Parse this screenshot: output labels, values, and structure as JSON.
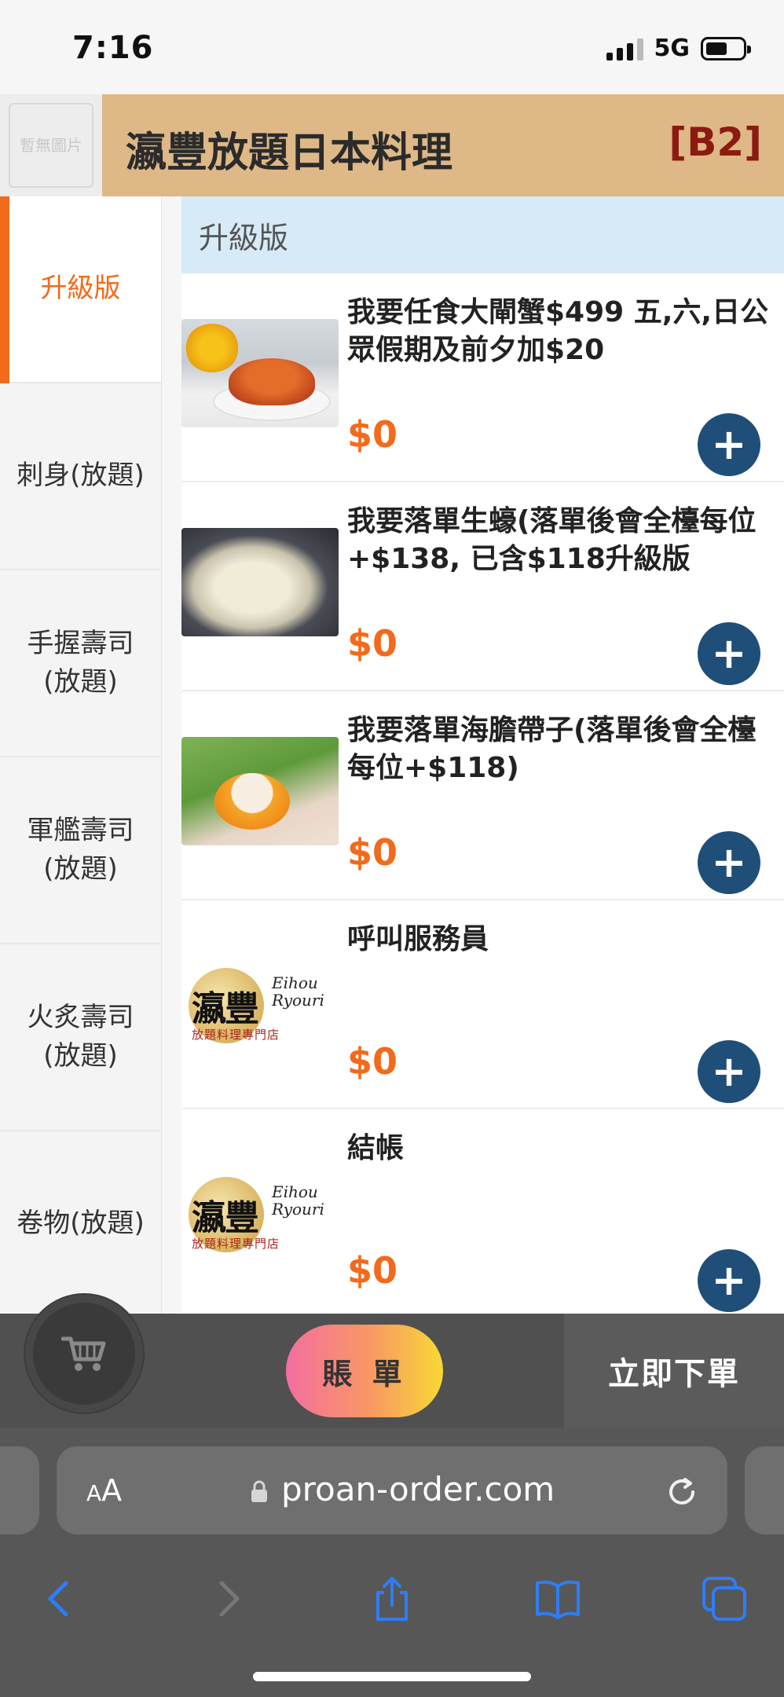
{
  "status_bar": {
    "time": "7:16",
    "network": "5G"
  },
  "header": {
    "store_name": "瀛豐放題日本料理",
    "table_code": "[B2]",
    "logo_placeholder": "暫無圖片"
  },
  "sidebar": {
    "categories": [
      {
        "label": "升級版",
        "active": true
      },
      {
        "label": "刺身(放題)"
      },
      {
        "label": "手握壽司\n(放題)"
      },
      {
        "label": "軍艦壽司\n(放題)"
      },
      {
        "label": "火炙壽司\n(放題)"
      },
      {
        "label": "卷物(放題)"
      }
    ]
  },
  "section": {
    "title": "升級版"
  },
  "items": [
    {
      "name": "我要任食大閘蟹$499 五,六,日公眾假期及前夕加$20",
      "price": "$0",
      "image": "crab-photo"
    },
    {
      "name": "我要落單生蠔(落單後會全檯每位+$138, 已含$118升級版",
      "price": "$0",
      "image": "oyster-photo"
    },
    {
      "name": "我要落單海膽帶子(落單後會全檯每位+$118)",
      "price": "$0",
      "image": "scallop-photo"
    },
    {
      "name": "呼叫服務員",
      "price": "$0",
      "image": "store-logo"
    },
    {
      "name": "結帳",
      "price": "$0",
      "image": "store-logo"
    }
  ],
  "logo_text": {
    "chars": "瀛豐",
    "roman_1": "Eihou",
    "roman_2": "Ryouri",
    "subtitle": "放題料理專門店"
  },
  "add_label": "+",
  "cart_bar": {
    "bill_label": "賬 單",
    "order_label": "立即下單"
  },
  "browser": {
    "text_size_label": "AA",
    "url": "proan-order.com"
  },
  "colors": {
    "accent_orange": "#f26a1b",
    "header_tan": "#deb887",
    "table_code_red": "#8b1a10",
    "add_button_blue": "#1f4e79",
    "section_blue": "#d6eaf8",
    "safari_blue": "#2f7df6"
  }
}
